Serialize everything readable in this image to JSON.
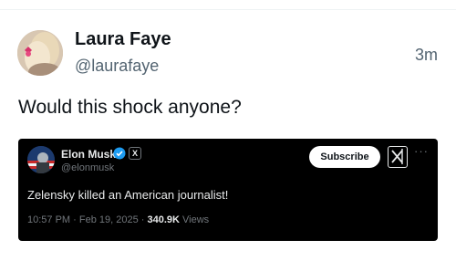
{
  "post": {
    "author_name": "Laura Faye",
    "author_handle": "@laurafaye",
    "time": "3m",
    "text": "Would this shock anyone?"
  },
  "quoted": {
    "name": "Elon Musk",
    "handle": "@elonmusk",
    "subscribe_label": "Subscribe",
    "text": "Zelensky killed an American journalist!",
    "timestamp": "10:57 PM · Feb 19, 2025 · ",
    "views_count": "340.9K",
    "views_label": "Views",
    "x_badge": "X",
    "more": "···"
  },
  "icons": {
    "verified": "verified-badge-icon",
    "affiliate": "x-badge-icon",
    "grok": "grok-icon",
    "more": "more-icon"
  },
  "colors": {
    "verified_blue": "#1d9bf0",
    "embed_bg": "#000000",
    "secondary_text": "#536471"
  }
}
